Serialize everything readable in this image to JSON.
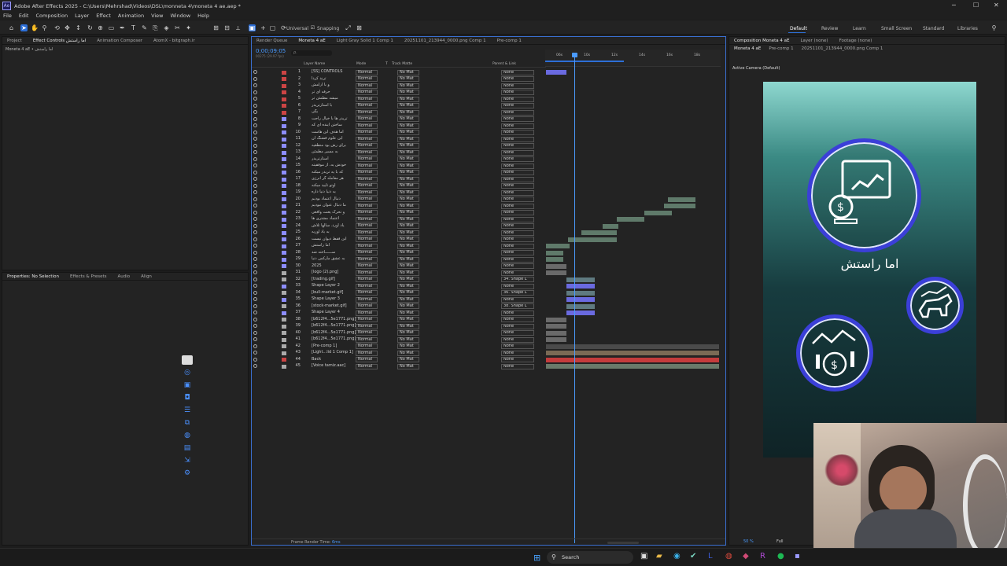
{
  "app": {
    "title": "Adobe After Effects 2025 - C:\\Users\\Mehrshad\\Videos\\DSL\\monneta 4\\moneta 4 ae.aep *",
    "logo": "Ae"
  },
  "menu": [
    "File",
    "Edit",
    "Composition",
    "Layer",
    "Effect",
    "Animation",
    "View",
    "Window",
    "Help"
  ],
  "toolbar": {
    "universal": "Universal",
    "snapping": "Snapping"
  },
  "workspaces": [
    "Default",
    "Review",
    "Learn",
    "Small Screen",
    "Standard",
    "Libraries"
  ],
  "left_panel": {
    "tabs": [
      "Project",
      "Effect Controls اما راستش",
      "Animation Composer",
      "AtomX - bitgraph.ir"
    ],
    "subtitle": "Moneta 4 aE • اما راستش",
    "lower_tabs": [
      "Properties: No Selection",
      "Effects & Presets",
      "Audio",
      "Align"
    ]
  },
  "timeline": {
    "tabs": [
      "Render Queue",
      "Moneta 4 aE",
      "Light Gray Solid 1 Comp 1",
      "20251101_213944_0000.png Comp 1",
      "Pre-comp 1"
    ],
    "timecode": "0;00;09;05",
    "timecode_sub": "00275 (29.97 fps)",
    "search_placeholder": "ρ.",
    "columns": [
      "Layer Name",
      "Mode",
      "T",
      "Track Matte",
      "Parent & Link"
    ],
    "ruler": [
      "06s",
      "10s",
      "12s",
      "14s",
      "16s",
      "18s"
    ],
    "frame_render_time_label": "Frame Render Time:",
    "frame_render_time_value": "6ms",
    "layers": [
      {
        "n": 1,
        "name": "[SS] CONTROLS",
        "color": "#c44",
        "mode": "Normal",
        "matte": "No Mat",
        "parent": "None"
      },
      {
        "n": 2,
        "name": "ترند کردا",
        "color": "#c44",
        "mode": "Normal",
        "matte": "No Mat",
        "parent": "None"
      },
      {
        "n": 3,
        "name": "و با آرامش",
        "color": "#c44",
        "mode": "Normal",
        "matte": "No Mat",
        "parent": "None"
      },
      {
        "n": 4,
        "name": "حرفه ای تر",
        "color": "#c44",
        "mode": "Normal",
        "matte": "No Mat",
        "parent": "None"
      },
      {
        "n": 5,
        "name": "میشه مطمئن تر",
        "color": "#c44",
        "mode": "Normal",
        "matte": "No Mat",
        "parent": "None"
      },
      {
        "n": 6,
        "name": "با استارتریدر",
        "color": "#c44",
        "mode": "Normal",
        "matte": "No Mat",
        "parent": "None"
      },
      {
        "n": 7,
        "name": "بگی",
        "color": "#c44",
        "mode": "Normal",
        "matte": "No Mat",
        "parent": "None"
      },
      {
        "n": 8,
        "name": "تریدر ها با خیال راحت",
        "color": "#8c8cff",
        "mode": "Normal",
        "matte": "No Mat",
        "parent": "None"
      },
      {
        "n": 9,
        "name": "ساختن آینده ای که",
        "color": "#8c8cff",
        "mode": "Normal",
        "matte": "No Mat",
        "parent": "None"
      },
      {
        "n": 10,
        "name": "اما هدف این هاست",
        "color": "#8c8cff",
        "mode": "Normal",
        "matte": "No Mat",
        "parent": "None"
      },
      {
        "n": 11,
        "name": "این علوم قشنگ آن",
        "color": "#8c8cff",
        "mode": "Normal",
        "matte": "No Mat",
        "parent": "None"
      },
      {
        "n": 12,
        "name": "برای رش بود منطقیه",
        "color": "#8c8cff",
        "mode": "Normal",
        "matte": "No Mat",
        "parent": "None"
      },
      {
        "n": 13,
        "name": "به مسیر مطمئن",
        "color": "#8c8cff",
        "mode": "Normal",
        "matte": "No Mat",
        "parent": "None"
      },
      {
        "n": 14,
        "name": "استارتریدر",
        "color": "#8c8cff",
        "mode": "Normal",
        "matte": "No Mat",
        "parent": "None"
      },
      {
        "n": 15,
        "name": "خودش یه، از موفقیته",
        "color": "#8c8cff",
        "mode": "Normal",
        "matte": "No Mat",
        "parent": "None"
      },
      {
        "n": 16,
        "name": "که با یه تریدر میکنه",
        "color": "#8c8cff",
        "mode": "Normal",
        "matte": "No Mat",
        "parent": "None"
      },
      {
        "n": 17,
        "name": "هر معامله گر انرژی",
        "color": "#8c8cff",
        "mode": "Normal",
        "matte": "No Mat",
        "parent": "None"
      },
      {
        "n": 18,
        "name": "اوتو تایید میکنه",
        "color": "#8c8cff",
        "mode": "Normal",
        "matte": "No Mat",
        "parent": "None"
      },
      {
        "n": 19,
        "name": "یه دنیا دنیا داره",
        "color": "#8c8cff",
        "mode": "Normal",
        "matte": "No Mat",
        "parent": "None"
      },
      {
        "n": 20,
        "name": "دنبال اعتماد بودیم",
        "color": "#8c8cff",
        "mode": "Normal",
        "matte": "No Mat",
        "parent": "None"
      },
      {
        "n": 21,
        "name": "ما دنبال عنوان نبودیم",
        "color": "#8c8cff",
        "mode": "Normal",
        "matte": "No Mat",
        "parent": "None"
      },
      {
        "n": 22,
        "name": "و تحرک یعنت واقعی",
        "color": "#8c8cff",
        "mode": "Normal",
        "matte": "No Mat",
        "parent": "None"
      },
      {
        "n": 23,
        "name": "اعتماد مشتری ها",
        "color": "#8c8cff",
        "mode": "Normal",
        "matte": "No Mat",
        "parent": "None"
      },
      {
        "n": 24,
        "name": "یاد آورد. سالها تلاش",
        "color": "#8c8cff",
        "mode": "Normal",
        "matte": "No Mat",
        "parent": "None"
      },
      {
        "n": 25,
        "name": "به یاد اوریه",
        "color": "#8c8cff",
        "mode": "Normal",
        "matte": "No Mat",
        "parent": "None"
      },
      {
        "n": 26,
        "name": "این فقط دیوان نیست",
        "color": "#8c8cff",
        "mode": "Normal",
        "matte": "No Mat",
        "parent": "None"
      },
      {
        "n": 27,
        "name": "اما راستش",
        "color": "#8c8cff",
        "mode": "Normal",
        "matte": "No Mat",
        "parent": "None"
      },
      {
        "n": 28,
        "name": "ســــــاخته شد",
        "color": "#8c8cff",
        "mode": "Normal",
        "matte": "No Mat",
        "parent": "None"
      },
      {
        "n": 29,
        "name": "به عشق مارکس دنیا",
        "color": "#8c8cff",
        "mode": "Normal",
        "matte": "No Mat",
        "parent": "None"
      },
      {
        "n": 30,
        "name": "2025",
        "color": "#8c8cff",
        "mode": "Normal",
        "matte": "No Mat",
        "parent": "None"
      },
      {
        "n": 31,
        "name": "[logo (2).png]",
        "color": "#aaa",
        "mode": "Normal",
        "matte": "No Mat",
        "parent": "None"
      },
      {
        "n": 32,
        "name": "[trading.gif]",
        "color": "#aaa",
        "mode": "Normal",
        "matte": "No Mat",
        "parent": "34. Shape L"
      },
      {
        "n": 33,
        "name": "Shape Layer 2",
        "color": "#8c8cff",
        "mode": "Normal",
        "matte": "No Mat",
        "parent": "None"
      },
      {
        "n": 34,
        "name": "[bull-market.gif]",
        "color": "#aaa",
        "mode": "Normal",
        "matte": "No Mat",
        "parent": "36. Shape L"
      },
      {
        "n": 35,
        "name": "Shape Layer 3",
        "color": "#8c8cff",
        "mode": "Normal",
        "matte": "No Mat",
        "parent": "None"
      },
      {
        "n": 36,
        "name": "[stock-market.gif]",
        "color": "#aaa",
        "mode": "Normal",
        "matte": "No Mat",
        "parent": "38. Shape L"
      },
      {
        "n": 37,
        "name": "Shape Layer 4",
        "color": "#8c8cff",
        "mode": "Normal",
        "matte": "No Mat",
        "parent": "None"
      },
      {
        "n": 38,
        "name": "[b612f4...5e1771.png]",
        "color": "#aaa",
        "mode": "Normal",
        "matte": "No Mat",
        "parent": "None"
      },
      {
        "n": 39,
        "name": "[b612f4...5e1771.png]",
        "color": "#aaa",
        "mode": "Normal",
        "matte": "No Mat",
        "parent": "None"
      },
      {
        "n": 40,
        "name": "[b612f4...5e1771.png]",
        "color": "#aaa",
        "mode": "Normal",
        "matte": "No Mat",
        "parent": "None"
      },
      {
        "n": 41,
        "name": "[b612f4...5e1771.png]",
        "color": "#aaa",
        "mode": "Normal",
        "matte": "No Mat",
        "parent": "None"
      },
      {
        "n": 42,
        "name": "[Pre-comp 1]",
        "color": "#aaa",
        "mode": "Normal",
        "matte": "No Mat",
        "parent": "None"
      },
      {
        "n": 43,
        "name": "[Light...lid 1 Comp 1]",
        "color": "#aaa",
        "mode": "Normal",
        "matte": "No Mat",
        "parent": "None"
      },
      {
        "n": 44,
        "name": "Back",
        "color": "#c44",
        "mode": "Normal",
        "matte": "No Mat",
        "parent": "None"
      },
      {
        "n": 45,
        "name": "[Voice tamiz.aac]",
        "color": "#aaa",
        "mode": "Normal",
        "matte": "No Mat",
        "parent": "None"
      }
    ]
  },
  "comp_panel": {
    "tabs": [
      "Composition Moneta 4 aE",
      "Layer (none)",
      "Footage (none)"
    ],
    "subtabs": [
      "Moneta 4 aE",
      "Pre-comp 1",
      "20251101_213944_0000.png Comp 1"
    ],
    "camera": "Active Camera (Default)",
    "caption": "اما راستش",
    "zoom": "50 %",
    "resolution": "Full"
  },
  "taskbar": {
    "search": "Search"
  },
  "colors": {
    "accent": "#2d6fd7",
    "ring": "#3b3fd8",
    "playhead": "#4a9bff"
  }
}
